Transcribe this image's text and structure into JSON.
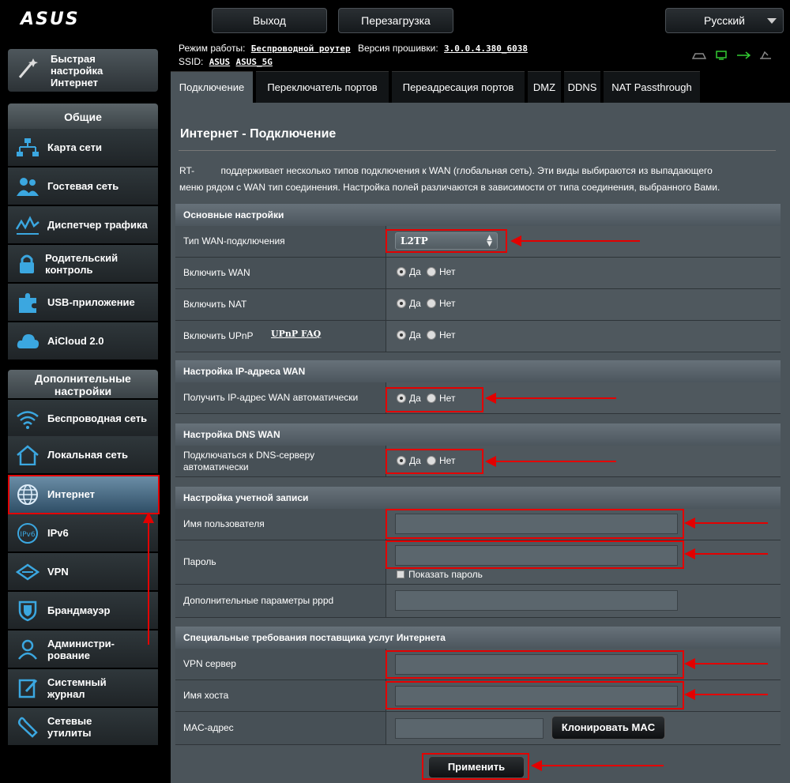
{
  "header": {
    "logo": "ASUS",
    "logout_label": "Выход",
    "reboot_label": "Перезагрузка",
    "language": "Русский"
  },
  "info": {
    "mode_label": "Режим работы:",
    "mode_value": "Беспроводной роутер",
    "firmware_label": "Версия прошивки:",
    "firmware_value": "3.0.0.4.380_6038",
    "ssid_label": "SSID:",
    "ssid_1": "ASUS",
    "ssid_2": "ASUS_5G"
  },
  "sidebar": {
    "quick_setup": "Быстрая настройка Интернет",
    "general_header": "Общие",
    "general_items": [
      {
        "label": "Карта сети",
        "icon": "network-map-icon"
      },
      {
        "label": "Гостевая сеть",
        "icon": "guest-network-icon"
      },
      {
        "label": "Диспетчер трафика",
        "icon": "traffic-icon"
      },
      {
        "label": "Родительский контроль",
        "icon": "lock-icon"
      },
      {
        "label": "USB-приложение",
        "icon": "puzzle-icon"
      },
      {
        "label": "AiCloud 2.0",
        "icon": "cloud-icon"
      }
    ],
    "advanced_header": "Дополнительные настройки",
    "advanced_items": [
      {
        "label": "Беспроводная сеть",
        "icon": "wifi-icon"
      },
      {
        "label": "Локальная сеть",
        "icon": "home-icon"
      },
      {
        "label": "Интернет",
        "icon": "globe-icon"
      },
      {
        "label": "IPv6",
        "icon": "ipv6-icon"
      },
      {
        "label": "VPN",
        "icon": "vpn-icon"
      },
      {
        "label": "Брандмауэр",
        "icon": "shield-icon"
      },
      {
        "label": "Администри-рование",
        "icon": "admin-icon"
      },
      {
        "label": "Системный журнал",
        "icon": "log-icon"
      },
      {
        "label": "Сетевые утилиты",
        "icon": "tools-icon"
      }
    ]
  },
  "tabs": [
    "Подключение",
    "Переключатель портов",
    "Переадресация портов",
    "DMZ",
    "DDNS",
    "NAT Passthrough"
  ],
  "main": {
    "title": "Интернет - Подключение",
    "desc_1": "RT-          поддерживает несколько типов подключения к WAN (глобальная сеть). Эти виды выбираются из выпадающего",
    "desc_2": "меню рядом с WAN тип соединения. Настройка полей различаются в зависимости от типа соединения, выбранного Вами.",
    "basic_header": "Основные настройки",
    "wan_type_label": "Тип WAN-подключения",
    "wan_type_value": "L2TP",
    "enable_wan_label": "Включить WAN",
    "enable_nat_label": "Включить NAT",
    "enable_upnp_label": "Включить UPnP",
    "upnp_faq": "UPnP FAQ",
    "yes": "Да",
    "no": "Нет",
    "ip_header": "Настройка IP-адреса WAN",
    "ip_auto_label": "Получить IP-адрес WAN автоматически",
    "dns_header": "Настройка DNS WAN",
    "dns_auto_label": "Подключаться к DNS-серверу автоматически",
    "account_header": "Настройка учетной записи",
    "username_label": "Имя пользователя",
    "password_label": "Пароль",
    "show_password": "Показать пароль",
    "pppd_label": "Дополнительные параметры pppd",
    "isp_header": "Специальные требования поставщика услуг Интернета",
    "vpn_server_label": "VPN сервер",
    "hostname_label": "Имя хоста",
    "mac_label": "MAC-адрес",
    "clone_mac": "Клонировать MAC",
    "apply": "Применить"
  },
  "colors": {
    "annotation": "#e30000",
    "panel": "#4b545a",
    "active_nav": "#3e6684"
  }
}
